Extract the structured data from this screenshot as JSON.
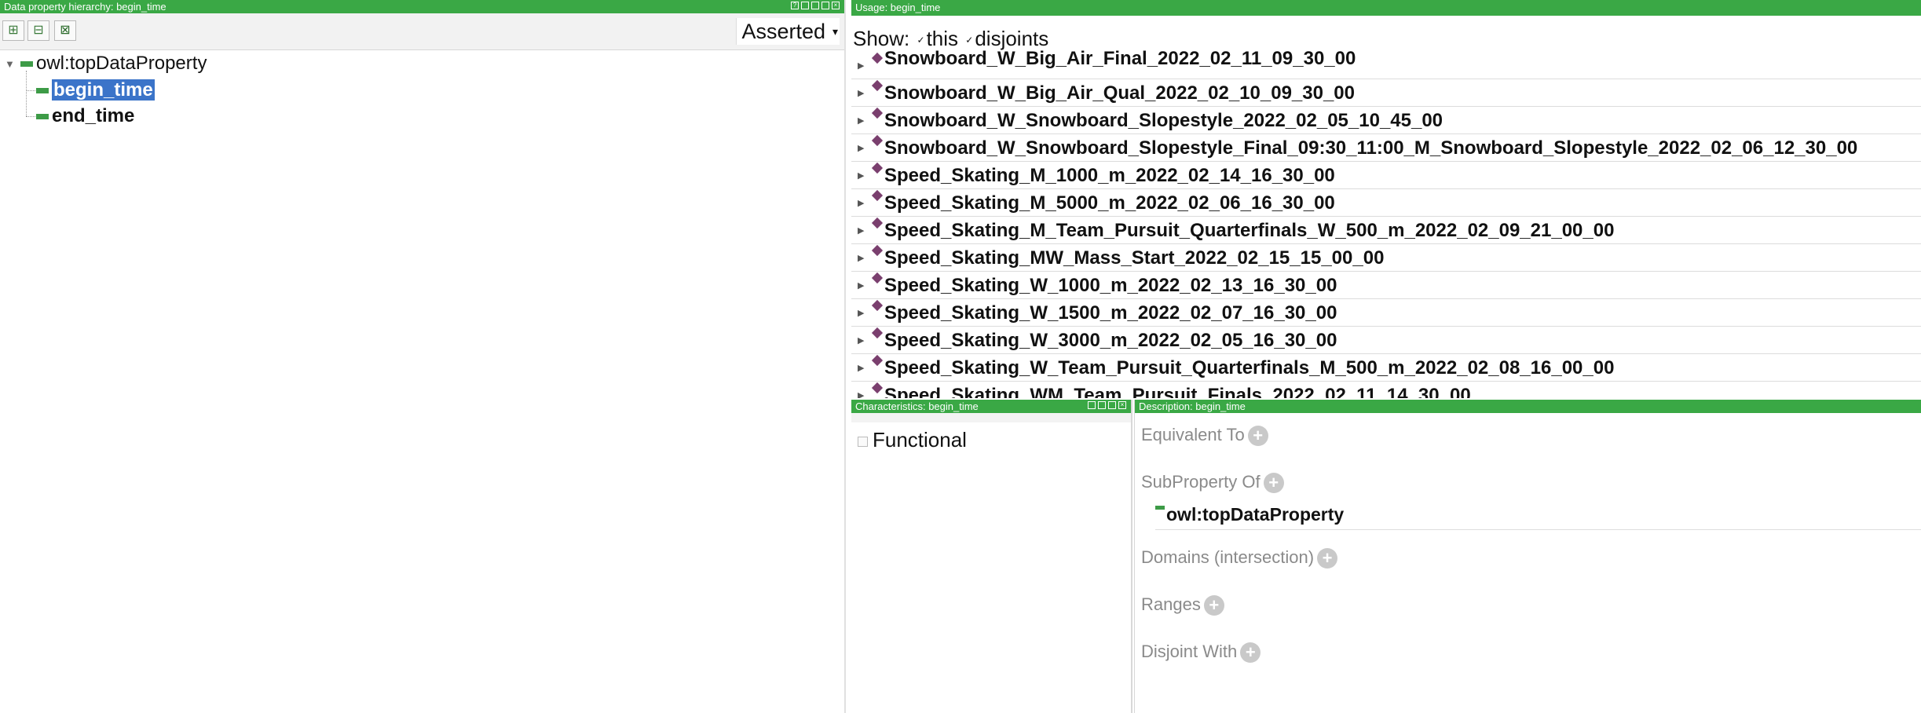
{
  "left_panel": {
    "title": "Data property hierarchy: begin_time",
    "toolbar": {
      "add_sub_icon": "add-subproperty-icon",
      "add_sibling_icon": "add-sibling-icon",
      "delete_icon": "delete-icon",
      "mode_label": "Asserted"
    },
    "tree": {
      "root": "owl:topDataProperty",
      "children": [
        "begin_time",
        "end_time"
      ],
      "selected": "begin_time"
    }
  },
  "usage_panel": {
    "title": "Usage: begin_time",
    "show_label": "Show:",
    "this_label": "this",
    "disjoints_label": "disjoints",
    "items": [
      "Snowboard_W_Big_Air_Final_2022_02_11_09_30_00",
      "Snowboard_W_Big_Air_Qual_2022_02_10_09_30_00",
      "Snowboard_W_Snowboard_Slopestyle_2022_02_05_10_45_00",
      "Snowboard_W_Snowboard_Slopestyle_Final_09:30_11:00_M_Snowboard_Slopestyle_2022_02_06_12_30_00",
      "Speed_Skating_M_1000_m_2022_02_14_16_30_00",
      "Speed_Skating_M_5000_m_2022_02_06_16_30_00",
      "Speed_Skating_M_Team_Pursuit_Quarterfinals_W_500_m_2022_02_09_21_00_00",
      "Speed_Skating_MW_Mass_Start_2022_02_15_15_00_00",
      "Speed_Skating_W_1000_m_2022_02_13_16_30_00",
      "Speed_Skating_W_1500_m_2022_02_07_16_30_00",
      "Speed_Skating_W_3000_m_2022_02_05_16_30_00",
      "Speed_Skating_W_Team_Pursuit_Quarterfinals_M_500_m_2022_02_08_16_00_00",
      "Speed_Skating_WM_Team_Pursuit_Finals_2022_02_11_14_30_00"
    ]
  },
  "characteristics_panel": {
    "title": "Characteristics: begin_time",
    "functional_label": "Functional"
  },
  "description_panel": {
    "title": "Description: begin_time",
    "equivalent_to": "Equivalent To",
    "subproperty_of": "SubProperty Of",
    "subproperty_value": "owl:topDataProperty",
    "domains": "Domains (intersection)",
    "ranges": "Ranges",
    "disjoint_with": "Disjoint With"
  },
  "colors": {
    "titlebar": "#3aa845",
    "selection": "#3b74c9",
    "individual_icon": "#7a3f6e"
  }
}
